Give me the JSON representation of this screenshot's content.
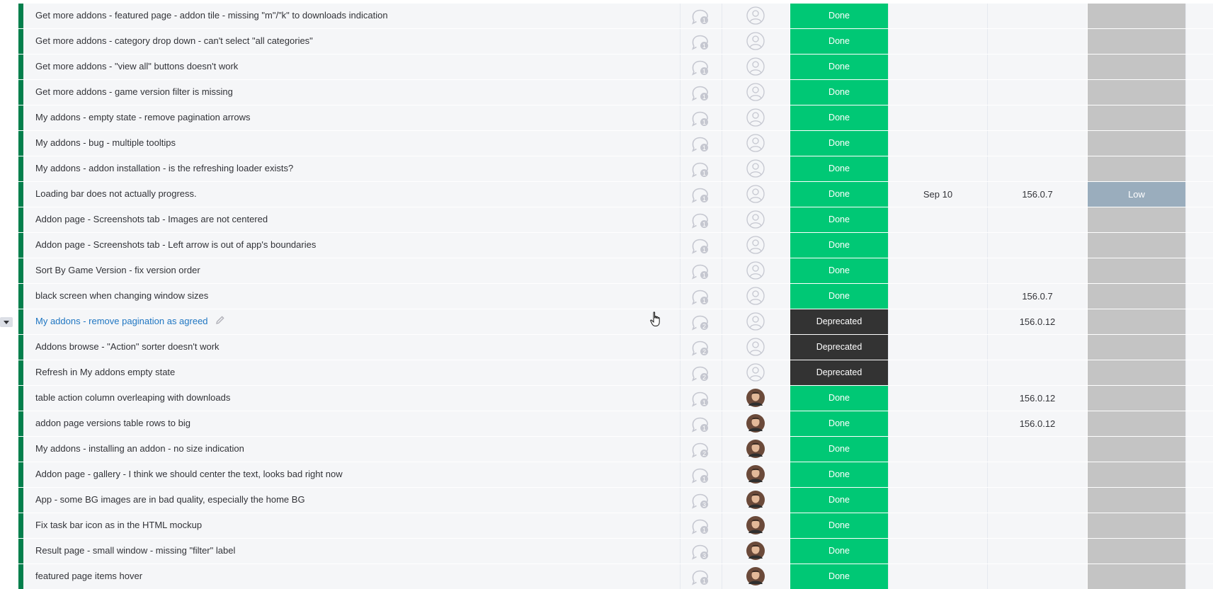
{
  "colors": {
    "group_accent": "#037f4c",
    "status_done": "#00c875",
    "status_deprecated": "#333333",
    "priority_empty": "#c4c4c4",
    "priority_low": "#9aadbd",
    "link_blue": "#1f76c2",
    "cell_bg": "#f5f6f8"
  },
  "rows": [
    {
      "name": "Get more addons - featured page - addon tile - missing \"m\"/\"k\" to downloads indication",
      "updates": "1",
      "owner": "empty",
      "status": "Done",
      "date": "",
      "version": "",
      "priority": ""
    },
    {
      "name": "Get more addons - category drop down - can't select \"all categories\"",
      "updates": "1",
      "owner": "empty",
      "status": "Done",
      "date": "",
      "version": "",
      "priority": ""
    },
    {
      "name": "Get more addons - \"view all\" buttons doesn't work",
      "updates": "1",
      "owner": "empty",
      "status": "Done",
      "date": "",
      "version": "",
      "priority": ""
    },
    {
      "name": "Get more addons - game version filter is missing",
      "updates": "1",
      "owner": "empty",
      "status": "Done",
      "date": "",
      "version": "",
      "priority": ""
    },
    {
      "name": "My addons - empty state - remove pagination arrows",
      "updates": "1",
      "owner": "empty",
      "status": "Done",
      "date": "",
      "version": "",
      "priority": ""
    },
    {
      "name": "My addons - bug - multiple tooltips",
      "updates": "1",
      "owner": "empty",
      "status": "Done",
      "date": "",
      "version": "",
      "priority": ""
    },
    {
      "name": "My addons - addon installation - is the refreshing loader exists?",
      "updates": "1",
      "owner": "empty",
      "status": "Done",
      "date": "",
      "version": "",
      "priority": ""
    },
    {
      "name": "Loading bar does not actually progress.",
      "updates": "1",
      "owner": "empty",
      "status": "Done",
      "date": "Sep 10",
      "version": "156.0.7",
      "priority": "Low"
    },
    {
      "name": "Addon page - Screenshots tab - Images are not centered",
      "updates": "1",
      "owner": "empty",
      "status": "Done",
      "date": "",
      "version": "",
      "priority": ""
    },
    {
      "name": "Addon page - Screenshots tab - Left arrow is out of app's boundaries",
      "updates": "1",
      "owner": "empty",
      "status": "Done",
      "date": "",
      "version": "",
      "priority": ""
    },
    {
      "name": "Sort By Game Version - fix version order",
      "updates": "1",
      "owner": "empty",
      "status": "Done",
      "date": "",
      "version": "",
      "priority": ""
    },
    {
      "name": "black screen when changing window sizes",
      "updates": "1",
      "owner": "empty",
      "status": "Done",
      "date": "",
      "version": "156.0.7",
      "priority": ""
    },
    {
      "name": "My addons - remove pagination as agreed",
      "updates": "2",
      "owner": "empty",
      "status": "Deprecated",
      "date": "",
      "version": "156.0.12",
      "priority": "",
      "active": true
    },
    {
      "name": "Addons browse - \"Action\" sorter doesn't work",
      "updates": "2",
      "owner": "empty",
      "status": "Deprecated",
      "date": "",
      "version": "",
      "priority": ""
    },
    {
      "name": "Refresh in My addons empty state",
      "updates": "2",
      "owner": "empty",
      "status": "Deprecated",
      "date": "",
      "version": "",
      "priority": ""
    },
    {
      "name": "table action column overleaping with downloads",
      "updates": "1",
      "owner": "photo",
      "status": "Done",
      "date": "",
      "version": "156.0.12",
      "priority": ""
    },
    {
      "name": "addon page versions table rows to big",
      "updates": "1",
      "owner": "photo",
      "status": "Done",
      "date": "",
      "version": "156.0.12",
      "priority": ""
    },
    {
      "name": "My addons - installing an addon - no size indication",
      "updates": "2",
      "owner": "photo",
      "status": "Done",
      "date": "",
      "version": "",
      "priority": ""
    },
    {
      "name": "Addon page - gallery - I think we should center the text, looks bad right now",
      "updates": "1",
      "owner": "photo",
      "status": "Done",
      "date": "",
      "version": "",
      "priority": ""
    },
    {
      "name": "App - some BG images are in bad quality, especially the home BG",
      "updates": "3",
      "owner": "photo",
      "status": "Done",
      "date": "",
      "version": "",
      "priority": ""
    },
    {
      "name": "Fix task bar icon as in the HTML mockup",
      "updates": "1",
      "owner": "photo",
      "status": "Done",
      "date": "",
      "version": "",
      "priority": ""
    },
    {
      "name": "Result page - small window - missing \"filter\" label",
      "updates": "3",
      "owner": "photo",
      "status": "Done",
      "date": "",
      "version": "",
      "priority": ""
    },
    {
      "name": "featured page items hover",
      "updates": "1",
      "owner": "photo",
      "status": "Done",
      "date": "",
      "version": "",
      "priority": ""
    }
  ]
}
